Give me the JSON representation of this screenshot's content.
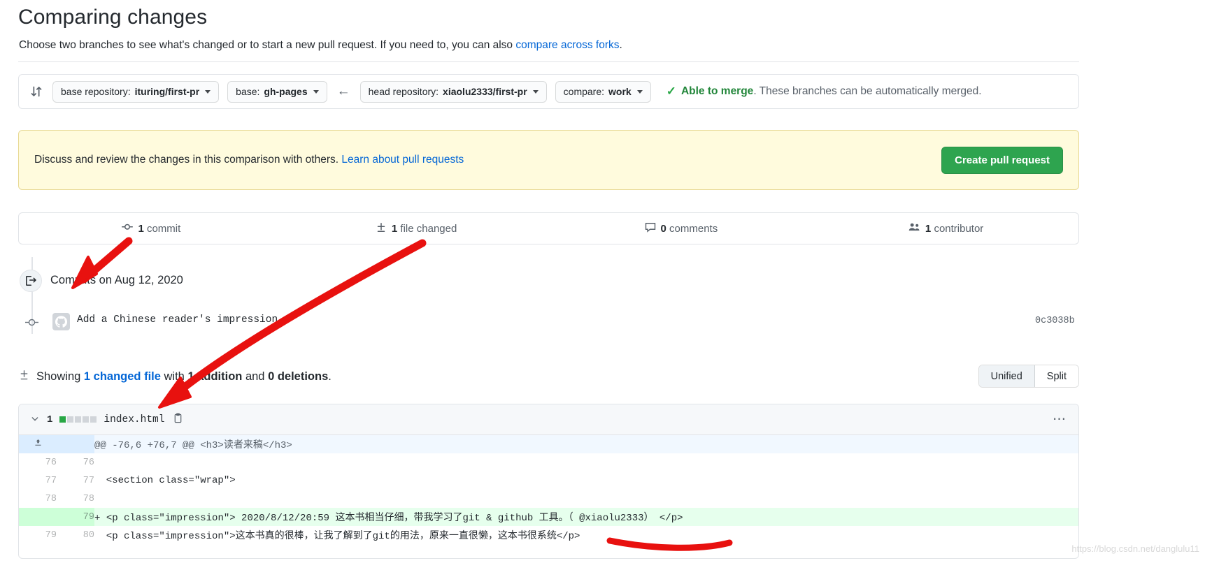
{
  "header": {
    "title": "Comparing changes",
    "subtitle_before": "Choose two branches to see what's changed or to start a new pull request. If you need to, you can also ",
    "subtitle_link": "compare across forks",
    "subtitle_after": "."
  },
  "branch_bar": {
    "compare_icon": "compare-icon",
    "base_repository_label": "base repository:",
    "base_repository_value": "ituring/first-pr",
    "base_label": "base:",
    "base_value": "gh-pages",
    "arrow": "←",
    "head_repository_label": "head repository:",
    "head_repository_value": "xiaolu2333/first-pr",
    "compare_label": "compare:",
    "compare_value": "work",
    "check_glyph": "✓",
    "merge_status_strong": "Able to merge",
    "merge_status_rest": ". These branches can be automatically merged."
  },
  "banner": {
    "text_before": "Discuss and review the changes in this comparison with others. ",
    "link": "Learn about pull requests",
    "button": "Create pull request",
    "accent_color": "#2ea44f",
    "background_color": "#fffbdd"
  },
  "stats": [
    {
      "icon": "commit-icon",
      "count": "1",
      "label": "commit"
    },
    {
      "icon": "diff-icon",
      "count": "1",
      "label": "file changed"
    },
    {
      "icon": "comment-icon",
      "count": "0",
      "label": "comments"
    },
    {
      "icon": "people-icon",
      "count": "1",
      "label": "contributor"
    }
  ],
  "commits": {
    "group_title": "Commits on Aug 12, 2020",
    "group_icon": "commit-push-icon",
    "items": [
      {
        "avatar": "github-avatar",
        "message": "Add a Chinese reader's impression",
        "sha": "0c3038b"
      }
    ]
  },
  "showing": {
    "prefix": "Showing ",
    "changed_file": "1 changed file",
    "with": " with ",
    "additions": "1 addition",
    "and": " and ",
    "deletions": "0 deletions",
    "suffix": ".",
    "toggle": {
      "unified": "Unified",
      "split": "Split",
      "active": "Unified"
    }
  },
  "file": {
    "chevron": "∨",
    "change_count": "1",
    "name": "index.html",
    "copy_icon": "copy-icon",
    "kebab": "⋯",
    "blocks": [
      "add",
      "empty",
      "empty",
      "empty",
      "empty"
    ],
    "hunk_header": "@@ -76,6 +76,7 @@ <h3>读者来稿</h3>",
    "rows": [
      {
        "type": "context",
        "old": "76",
        "new": "76",
        "marker": "",
        "code": ""
      },
      {
        "type": "context",
        "old": "77",
        "new": "77",
        "marker": "",
        "code": "  <section class=\"wrap\">"
      },
      {
        "type": "context",
        "old": "78",
        "new": "78",
        "marker": "",
        "code": ""
      },
      {
        "type": "add",
        "old": "",
        "new": "79",
        "marker": "+",
        "code": "<p class=\"impression\"> 2020/8/12/20:59 这本书相当仔细，带我学习了git & github 工具。（ @xiaolu2333） </p>"
      },
      {
        "type": "context",
        "old": "79",
        "new": "80",
        "marker": "",
        "code": "  <p class=\"impression\">这本书真的很棒，让我了解到了git的用法，原来一直很懒，这本书很系统</p>"
      }
    ]
  },
  "watermark": "https://blog.csdn.net/danglulu11"
}
